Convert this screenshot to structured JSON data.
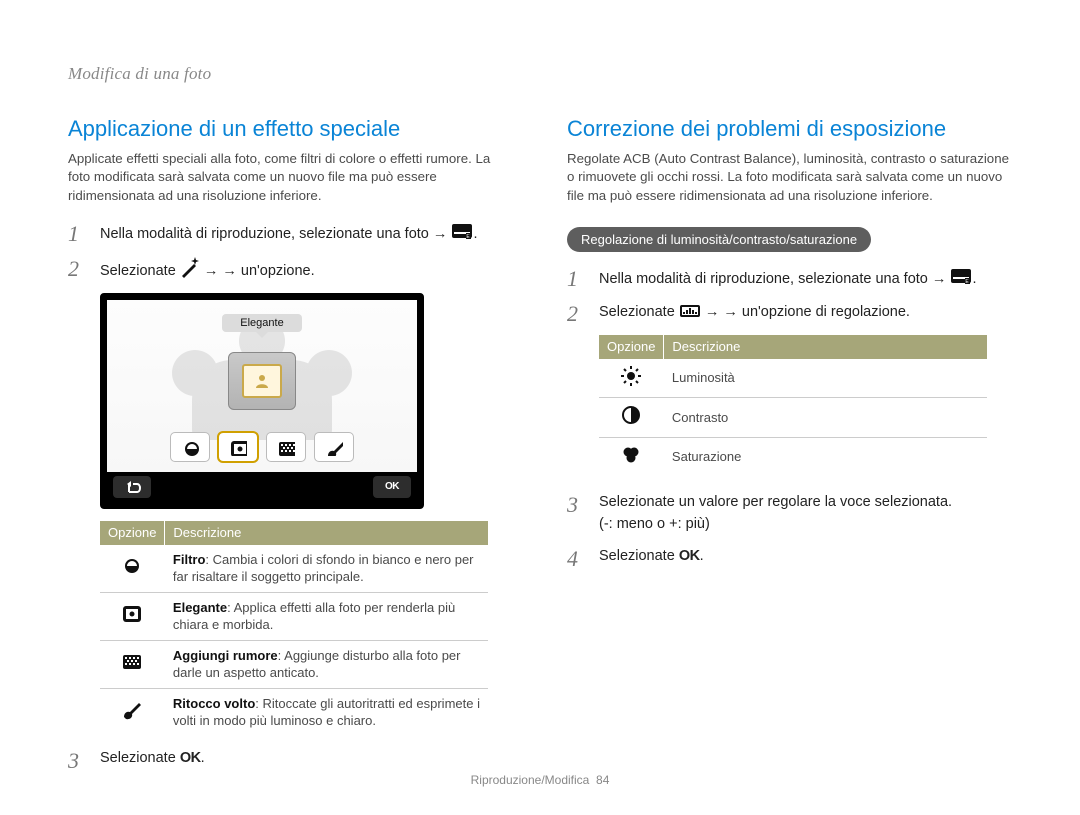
{
  "page_header": "Modifica di una foto",
  "page_footer": {
    "section": "Riproduzione/Modifica",
    "number": "84"
  },
  "left": {
    "heading": "Applicazione di un effetto speciale",
    "intro": "Applicate effetti speciali alla foto, come filtri di colore o effetti rumore. La foto modificata sarà salvata come un nuovo file ma può essere ridimensionata ad una risoluzione inferiore.",
    "steps": {
      "s1": "Nella modalità di riproduzione, selezionate una foto →",
      "s2_pre": "Selezionate",
      "s2_post": "→ un'opzione.",
      "s3_pre": "Selezionate"
    },
    "screen": {
      "bubble_label": "Elegante"
    },
    "table": {
      "th1": "Opzione",
      "th2": "Descrizione",
      "rows": [
        {
          "icon": "filter-icon",
          "title": "Filtro",
          "desc": ": Cambia i colori di sfondo in bianco e nero per far risaltare il soggetto principale."
        },
        {
          "icon": "elegant-icon",
          "title": "Elegante",
          "desc": ": Applica effetti alla foto per renderla più chiara e morbida."
        },
        {
          "icon": "noise-icon",
          "title": "Aggiungi rumore",
          "desc": ": Aggiunge disturbo alla foto per darle un aspetto anticato."
        },
        {
          "icon": "face-retouch-icon",
          "title": "Ritocco volto",
          "desc": ": Ritoccate gli autoritratti ed esprimete i volti in modo più luminoso e chiaro."
        }
      ]
    }
  },
  "right": {
    "heading": "Correzione dei problemi di esposizione",
    "intro": "Regolate ACB (Auto Contrast Balance), luminosità, contrasto o saturazione o rimuovete gli occhi rossi. La foto modificata sarà salvata come un nuovo file ma può essere ridimensionata ad una risoluzione inferiore.",
    "pill": "Regolazione di luminosità/contrasto/saturazione",
    "steps": {
      "s1": "Nella modalità di riproduzione, selezionate una foto →",
      "s2_pre": "Selezionate",
      "s2_post": "→ un'opzione di regolazione.",
      "s3_a": "Selezionate un valore per regolare la voce selezionata.",
      "s3_b": "(-: meno o +: più)",
      "s4_pre": "Selezionate"
    },
    "table": {
      "th1": "Opzione",
      "th2": "Descrizione",
      "rows": [
        {
          "icon": "brightness-icon",
          "label": "Luminosità"
        },
        {
          "icon": "contrast-icon",
          "label": "Contrasto"
        },
        {
          "icon": "saturation-icon",
          "label": "Saturazione"
        }
      ]
    }
  }
}
